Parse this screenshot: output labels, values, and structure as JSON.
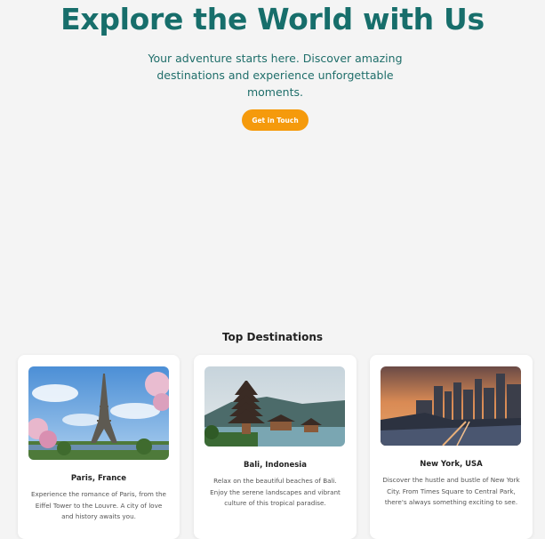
{
  "hero": {
    "title": "Explore the World with Us",
    "subtitle": "Your adventure starts here. Discover amazing destinations and experience unforgettable moments.",
    "cta_label": "Get in Touch"
  },
  "destinations": {
    "heading": "Top Destinations",
    "cards": [
      {
        "title": "Paris, France",
        "description": "Experience the romance of Paris, from the Eiffel Tower to the Louvre. A city of love and history awaits you.",
        "image": "eiffel-tower-photo"
      },
      {
        "title": "Bali, Indonesia",
        "description": "Relax on the beautiful beaches of Bali. Enjoy the serene landscapes and vibrant culture of this tropical paradise.",
        "image": "bali-temple-photo"
      },
      {
        "title": "New York, USA",
        "description": "Discover the hustle and bustle of New York City. From Times Square to Central Park, there's always something exciting to see.",
        "image": "new-york-skyline-photo"
      }
    ]
  },
  "colors": {
    "background": "#f4f4f4",
    "brand_teal": "#176e6b",
    "accent_orange": "#f59a0c",
    "card_bg": "#ffffff",
    "text_dark": "#222222",
    "text_muted": "#555555"
  }
}
